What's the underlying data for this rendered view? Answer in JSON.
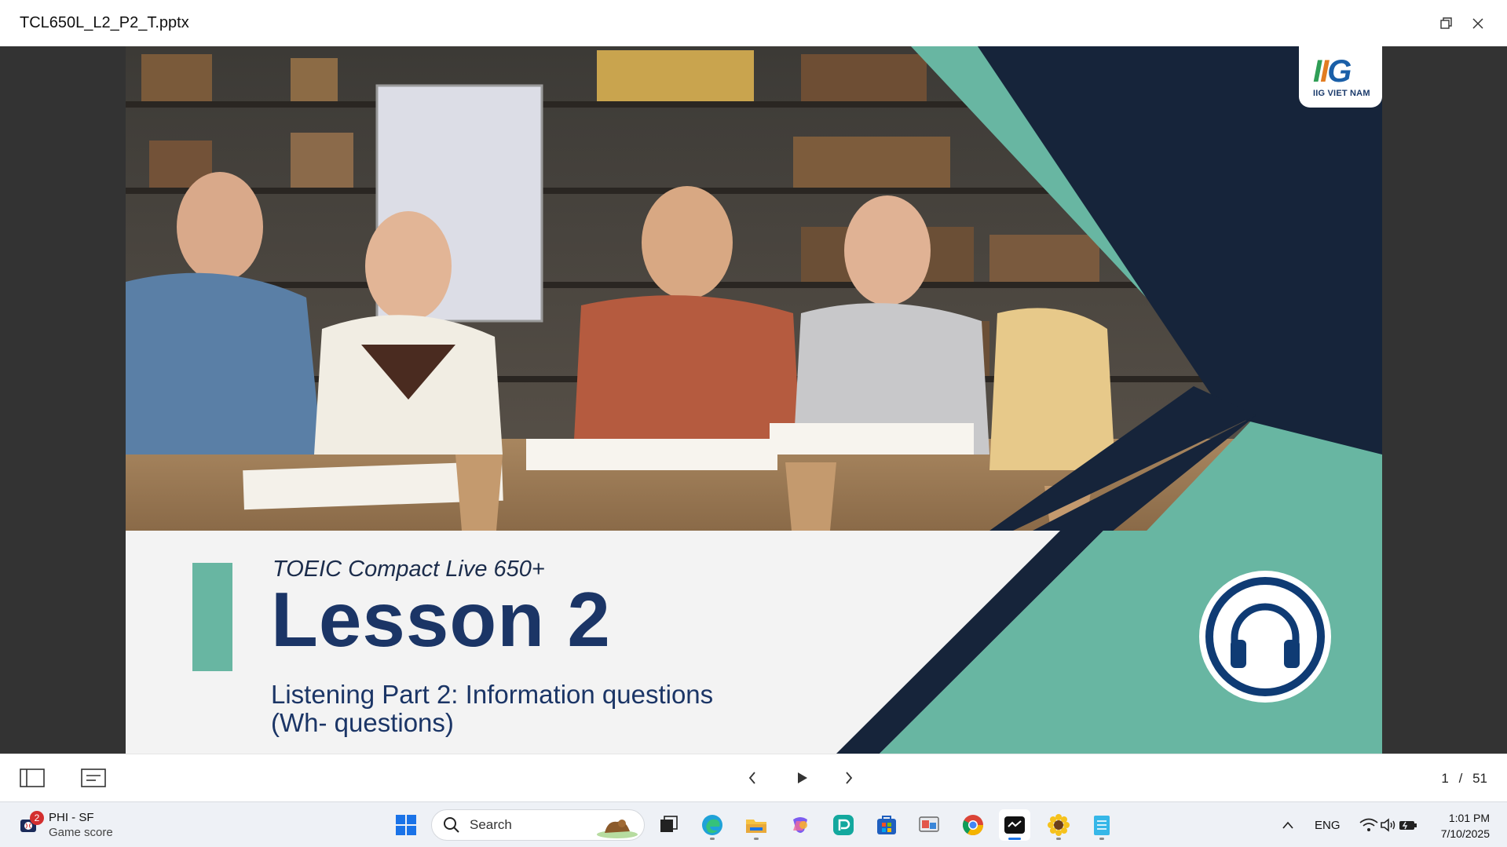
{
  "window": {
    "title": "TCL650L_L2_P2_T.pptx",
    "restore_icon": "restore-icon",
    "close_icon": "close-icon"
  },
  "slide": {
    "logo_text": "IIG VIET NAM",
    "logo_mark": "IIG",
    "course": "TOEIC Compact Live 650+",
    "lesson": "Lesson 2",
    "description_line1": "Listening Part 2: Information questions",
    "description_line2": "(Wh- questions)",
    "colors": {
      "navy": "#16243a",
      "teal": "#68b6a2",
      "title": "#1b3566"
    },
    "icon": "headphones-icon"
  },
  "viewer": {
    "current_page": "1",
    "separator": "/",
    "total_pages": "51",
    "icons": [
      "panel-toggle-icon",
      "notes-icon",
      "previous-slide-icon",
      "play-icon",
      "next-slide-icon"
    ]
  },
  "taskbar": {
    "widget_line1": "PHI - SF",
    "widget_line2": "Game score",
    "widget_badge": "2",
    "search_label": "Search",
    "language": "ENG",
    "time": "1:01 PM",
    "date": "7/10/2025"
  }
}
